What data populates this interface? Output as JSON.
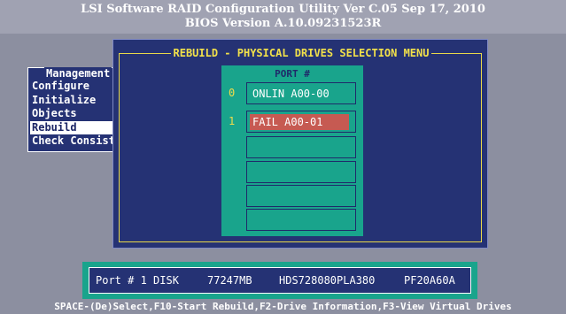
{
  "header": {
    "line1": "LSI Software RAID Configuration Utility Ver C.05 Sep 17, 2010",
    "line2": "BIOS Version   A.10.09231523R"
  },
  "management_menu": {
    "title": "Management",
    "items": [
      {
        "label": "Configure",
        "selected": false
      },
      {
        "label": "Initialize",
        "selected": false
      },
      {
        "label": "Objects",
        "selected": false
      },
      {
        "label": "Rebuild",
        "selected": true
      },
      {
        "label": "Check Consist",
        "selected": false
      }
    ]
  },
  "rebuild_dialog": {
    "title": "REBUILD - PHYSICAL DRIVES SELECTION MENU",
    "port_header": "PORT #",
    "slots": [
      {
        "num": "0",
        "text": "ONLIN A00-00",
        "status": "online"
      },
      {
        "num": "1",
        "text": "FAIL  A00-01",
        "status": "fail"
      },
      {
        "num": "",
        "text": "",
        "status": "empty"
      },
      {
        "num": "",
        "text": "",
        "status": "empty"
      },
      {
        "num": "",
        "text": "",
        "status": "empty"
      },
      {
        "num": "",
        "text": "",
        "status": "empty"
      }
    ]
  },
  "drive_info": {
    "port": "Port # 1 DISK",
    "size": "77247MB",
    "model": "HDS728080PLA380",
    "firmware": "PF20A60A"
  },
  "status_bar": {
    "text": "SPACE-(De)Select,F10-Start Rebuild,F2-Drive Information,F3-View Virtual Drives"
  },
  "colors": {
    "background": "#8c8fa0",
    "panel_blue": "#253274",
    "teal": "#19a48c",
    "fail_highlight": "#c65a52",
    "title_yellow": "#f2e14a"
  }
}
